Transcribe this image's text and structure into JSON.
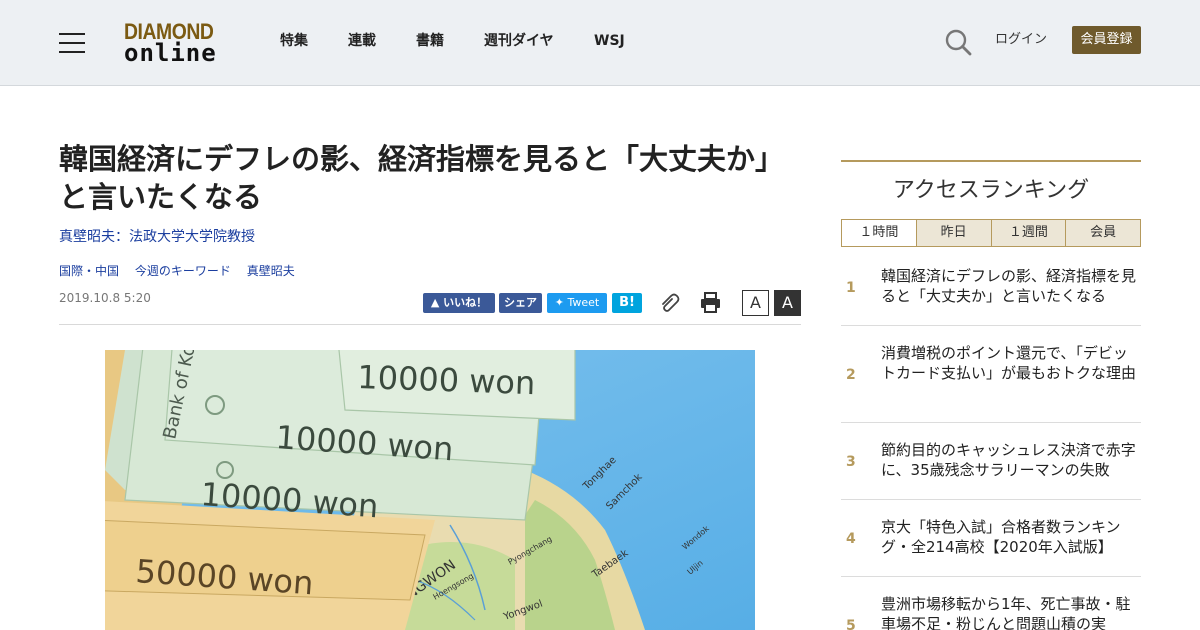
{
  "header": {
    "logo_top": "DIAMOND",
    "logo_bottom": "online",
    "nav": [
      "特集",
      "連載",
      "書籍",
      "週刊ダイヤ",
      "WSJ"
    ],
    "login_label": "ログイン",
    "register_label": "会員登録"
  },
  "article": {
    "title": "韓国経済にデフレの影、経済指標を見ると「大丈夫か」と言いたくなる",
    "author": "真壁昭夫：法政大学大学院教授",
    "tags": [
      "国際・中国",
      "今週のキーワード",
      "真壁昭夫"
    ],
    "date": "2019.10.8 5:20",
    "share": {
      "like": "いいね！",
      "fb_share": "シェア",
      "tweet": "Tweet",
      "hatena": "B!"
    },
    "font_small": "A",
    "font_large": "A",
    "image": {
      "notes": [
        "10000 won",
        "10000 won",
        "10000 won",
        "50000 won"
      ],
      "bank_text": "Bank of Korea",
      "map_labels": [
        "Tonghae",
        "Samchok",
        "KANGWON",
        "Taebaek",
        "Yongwol",
        "Wondok",
        "Uljin",
        "Pyongchang",
        "Hoengsong"
      ]
    }
  },
  "sidebar": {
    "title": "アクセスランキング",
    "tabs": [
      "１時間",
      "昨日",
      "１週間",
      "会員"
    ],
    "ranking": [
      {
        "num": "1",
        "text": "韓国経済にデフレの影、経済指標を見ると「大丈夫か」と言いたくなる"
      },
      {
        "num": "2",
        "text": "消費増税のポイント還元で、「デビットカード支払い」が最もおトクな理由"
      },
      {
        "num": "3",
        "text": "節約目的のキャッシュレス決済で赤字に、35歳残念サラリーマンの失敗"
      },
      {
        "num": "4",
        "text": "京大「特色入試」合格者数ランキング・全214高校【2020年入試版】"
      },
      {
        "num": "5",
        "text": "豊洲市場移転から1年、死亡事故・駐車場不足・粉じんと問題山積の実"
      }
    ]
  },
  "colors": {
    "accent_gold": "#b59a5d",
    "link_blue": "#1b3e9f",
    "register_bg": "#6f5a2c",
    "header_bg": "#edf0f3"
  }
}
